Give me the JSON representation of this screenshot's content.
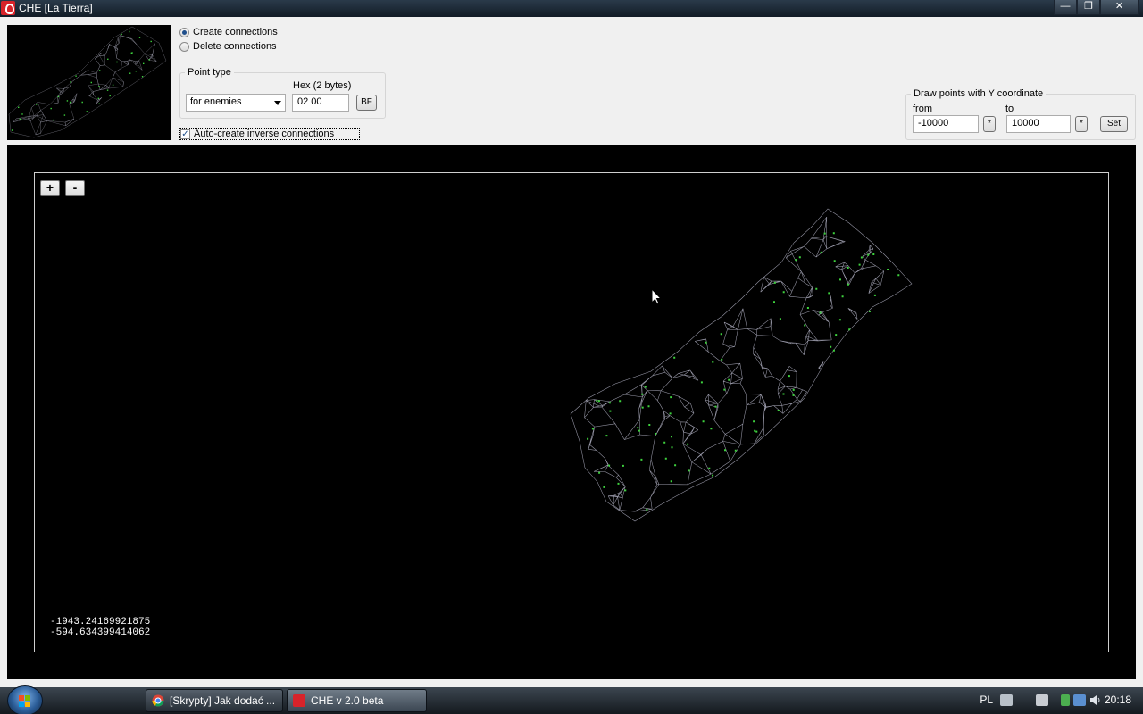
{
  "window": {
    "title": "CHE [La Tierra]",
    "buttons": {
      "minimize": "—",
      "maximize": "❐",
      "close": "✕"
    }
  },
  "mode": {
    "create_label": "Create connections",
    "delete_label": "Delete connections",
    "selected": "create"
  },
  "point_type": {
    "legend": "Point type",
    "hex_label": "Hex (2 bytes)",
    "selected": "for enemies",
    "hex_value": "02 00",
    "bf_button": "BF"
  },
  "auto_inverse": {
    "label": "Auto-create inverse connections",
    "checked": true
  },
  "y_filter": {
    "legend": "Draw points with  Y coordinate",
    "from_label": "from",
    "to_label": "to",
    "from_value": "-10000",
    "to_value": "10000",
    "star_label": "*",
    "set_button": "Set"
  },
  "canvas": {
    "zoom_in": "+",
    "zoom_out": "-",
    "coord_x": "-1943.24169921875",
    "coord_y": "-594.634399414062"
  },
  "taskbar": {
    "tasks": [
      {
        "label": "[Skrypty] Jak dodać ..."
      },
      {
        "label": "CHE v 2.0 beta"
      }
    ],
    "language": "PL",
    "clock": "20:18"
  },
  "colors": {
    "mesh_line": "#9a9aaa",
    "mesh_point": "#3ed23e",
    "accent_red": "#d8232a"
  }
}
